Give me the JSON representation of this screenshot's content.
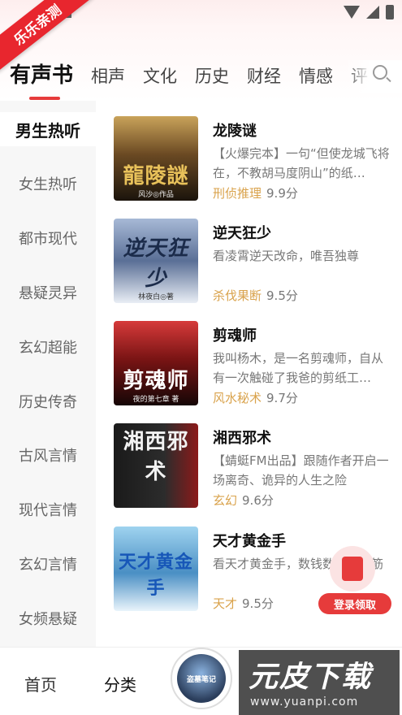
{
  "app": {
    "ribbon_text": "乐乐亲测"
  },
  "tabs": [
    {
      "label": "有声书",
      "active": true
    },
    {
      "label": "相声"
    },
    {
      "label": "文化"
    },
    {
      "label": "历史"
    },
    {
      "label": "财经"
    },
    {
      "label": "情感"
    },
    {
      "label": "评"
    }
  ],
  "sidebar": {
    "items": [
      {
        "label": "男生热听",
        "active": true
      },
      {
        "label": "女生热听"
      },
      {
        "label": "都市现代"
      },
      {
        "label": "悬疑灵异"
      },
      {
        "label": "玄幻超能"
      },
      {
        "label": "历史传奇"
      },
      {
        "label": "古风言情"
      },
      {
        "label": "现代言情"
      },
      {
        "label": "玄幻言情"
      },
      {
        "label": "女频悬疑"
      }
    ]
  },
  "books": [
    {
      "title": "龙陵谜",
      "desc": "【火爆完本】一句“但使龙城飞将在，不教胡马度阴山”的纸…",
      "genre": "刑侦推理",
      "score": "9.9分",
      "cover_text": "龍陵謎",
      "cover_sub": "风沙◎作品"
    },
    {
      "title": "逆天狂少",
      "desc": "看凌霄逆天改命，唯吾独尊",
      "genre": "杀伐果断",
      "score": "9.5分",
      "cover_text": "逆天狂少",
      "cover_sub": "林夜白◎著"
    },
    {
      "title": "剪魂师",
      "desc": "我叫杨木，是一名剪魂师，自从有一次触碰了我爸的剪纸工…",
      "genre": "风水秘术",
      "score": "9.7分",
      "cover_text": "剪魂师",
      "cover_sub": "夜的第七章 著"
    },
    {
      "title": "湘西邪术",
      "desc": "【蜻蜓FM出品】跟随作者开启一场离奇、诡异的人生之险",
      "genre": "玄幻",
      "score": "9.6分",
      "cover_text": "湘西邪术",
      "cover_sub": ""
    },
    {
      "title": "天才黄金手",
      "desc": "看天才黄金手，数钱数到手抽筋",
      "genre": "天才",
      "score": "9.5分",
      "cover_text": "天才黄金手",
      "cover_sub": ""
    }
  ],
  "promo": {
    "button_label": "登录领取"
  },
  "bottom_nav": {
    "home": "首页",
    "category": "分类",
    "center_text": "盗墓笔记"
  },
  "watermark": {
    "brand": "元皮下载",
    "url": "www.yuanpi.com"
  },
  "colors": {
    "accent": "#e63b3b",
    "genre": "#d9a24b",
    "ribbon": "#e8262e"
  }
}
